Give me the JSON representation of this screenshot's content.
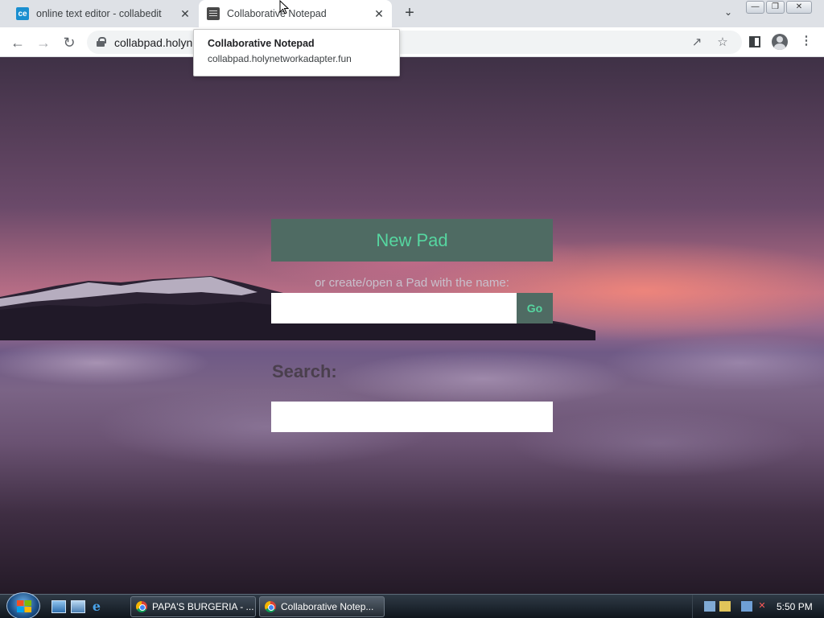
{
  "browser": {
    "tabs": [
      {
        "title": "online text editor - collabedit",
        "favicon": "ce",
        "active": false
      },
      {
        "title": "Collaborative Notepad",
        "favicon": "notepad-icon",
        "active": true
      }
    ],
    "new_tab_label": "+",
    "url": "collabpad.holyn"
  },
  "tooltip": {
    "title": "Collaborative Notepad",
    "url": "collabpad.holynetworkadapter.fun"
  },
  "page": {
    "new_pad_label": "New Pad",
    "or_text": "or create/open a Pad with the name:",
    "name_input_value": "",
    "go_label": "Go",
    "search_label": "Search:",
    "search_input_value": "",
    "accent_color": "#56d6a0",
    "button_color": "#4f6b63"
  },
  "taskbar": {
    "items": [
      {
        "label": "PAPA'S BURGERIA - ...",
        "active": false
      },
      {
        "label": "Collaborative Notep...",
        "active": true
      }
    ],
    "clock": "5:50 PM"
  }
}
